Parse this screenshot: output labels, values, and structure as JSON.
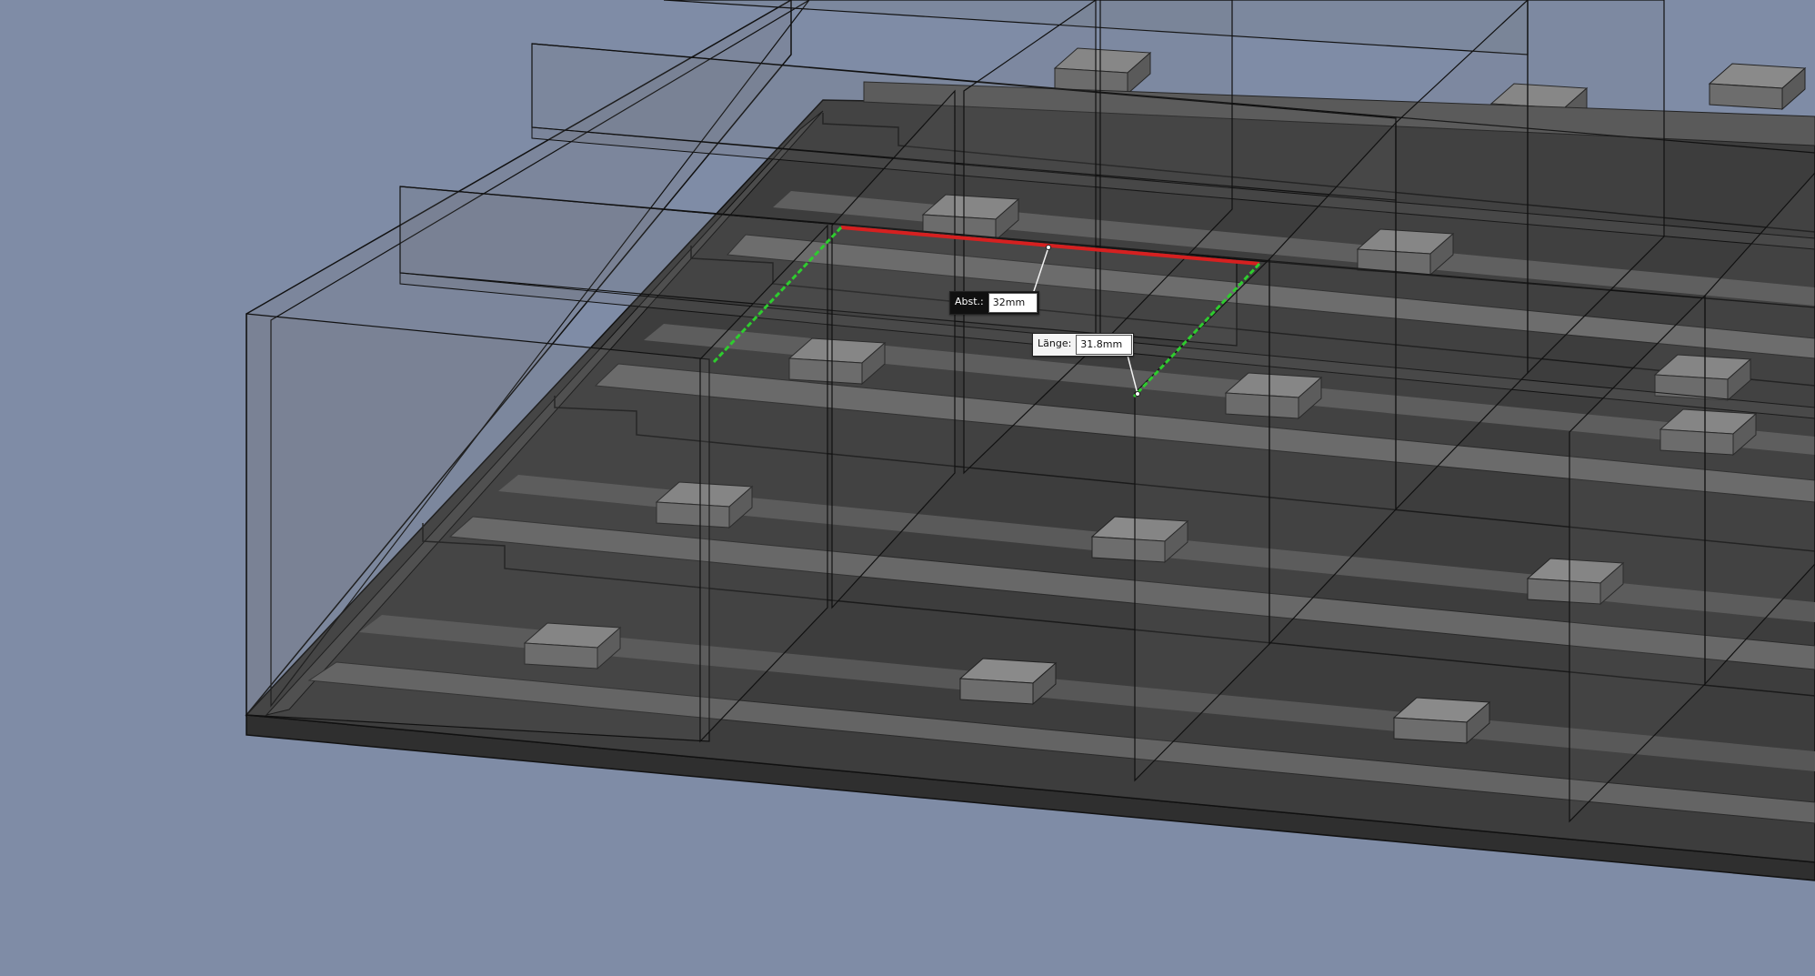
{
  "viewport": {
    "background": "#7f8ca6"
  },
  "dimensions": {
    "distance": {
      "label": "Abst.:",
      "value": "32mm"
    },
    "length": {
      "label": "Länge:",
      "value": "31.8mm"
    }
  },
  "colors": {
    "selected_edge": "#d62020",
    "reference_edge": "#2ecc2e",
    "base_plate": "#3b3b3b",
    "wire": "#111111"
  }
}
